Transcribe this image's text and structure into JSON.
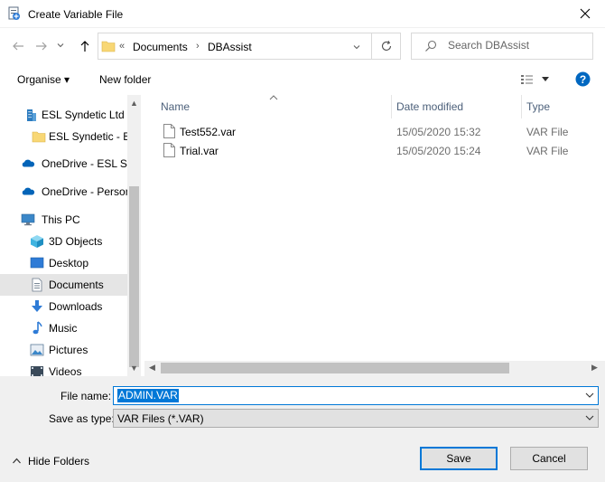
{
  "window": {
    "title": "Create Variable File"
  },
  "address": {
    "overflow": "«",
    "crumbs": [
      "Documents",
      "DBAssist"
    ]
  },
  "search": {
    "placeholder": "Search DBAssist"
  },
  "toolbar": {
    "organise": "Organise ▾",
    "new_folder": "New folder"
  },
  "nav": {
    "items": [
      {
        "label": "ESL Syndetic Ltd",
        "icon": "building-icon"
      },
      {
        "label": "ESL Syndetic - ESL",
        "icon": "folder-icon"
      },
      {
        "label": "OneDrive - ESL Syndetic",
        "icon": "cloud-icon"
      },
      {
        "label": "OneDrive - Personal",
        "icon": "cloud-icon"
      },
      {
        "label": "This PC",
        "icon": "pc-icon"
      },
      {
        "label": "3D Objects",
        "icon": "cube-icon"
      },
      {
        "label": "Desktop",
        "icon": "desktop-icon"
      },
      {
        "label": "Documents",
        "icon": "documents-icon"
      },
      {
        "label": "Downloads",
        "icon": "download-icon"
      },
      {
        "label": "Music",
        "icon": "music-icon"
      },
      {
        "label": "Pictures",
        "icon": "pictures-icon"
      },
      {
        "label": "Videos",
        "icon": "videos-icon"
      }
    ],
    "selected": "Documents"
  },
  "files": {
    "columns": {
      "name": "Name",
      "date": "Date modified",
      "type": "Type"
    },
    "rows": [
      {
        "name": "Test552.var",
        "date": "15/05/2020 15:32",
        "type": "VAR File"
      },
      {
        "name": "Trial.var",
        "date": "15/05/2020 15:24",
        "type": "VAR File"
      }
    ]
  },
  "form": {
    "file_name_label": "File name:",
    "file_name_value": "ADMIN.VAR",
    "save_type_label": "Save as type:",
    "save_type_value": "VAR Files (*.VAR)"
  },
  "footer": {
    "hide_folders": "Hide Folders",
    "save": "Save",
    "cancel": "Cancel"
  },
  "colors": {
    "accent": "#0078d7",
    "folder": "#f8d775",
    "onedrive": "#0364b8"
  }
}
